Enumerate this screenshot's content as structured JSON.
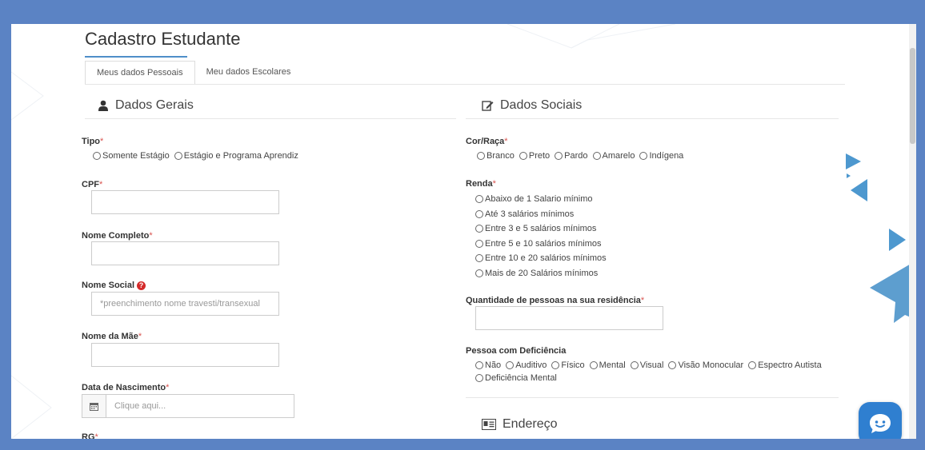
{
  "page": {
    "title": "Cadastro Estudante",
    "tabs": [
      {
        "label": "Meus dados Pessoais",
        "active": true
      },
      {
        "label": "Meu dados Escolares",
        "active": false
      }
    ]
  },
  "colors": {
    "frame": "#5b83c4",
    "accent": "#4f8fc9",
    "required": "#d9534f",
    "chat": "#2f7fd0"
  },
  "left": {
    "header": "Dados Gerais",
    "header_icon": "user-icon",
    "tipo": {
      "label": "Tipo",
      "required": "*",
      "options": [
        "Somente Estágio",
        "Estágio e Programa Aprendiz"
      ]
    },
    "cpf": {
      "label": "CPF",
      "required": "*",
      "value": ""
    },
    "nome_completo": {
      "label": "Nome Completo",
      "required": "*",
      "value": ""
    },
    "nome_social": {
      "label": "Nome Social",
      "help_icon": "question-circle-icon",
      "help_glyph": "?",
      "placeholder": "*preenchimento nome travesti/transexual"
    },
    "nome_mae": {
      "label": "Nome da Mãe",
      "required": "*",
      "value": ""
    },
    "data_nascimento": {
      "label": "Data de Nascimento",
      "required": "*",
      "icon": "calendar-icon",
      "placeholder": "Clique aqui..."
    },
    "rg": {
      "label": "RG",
      "required": "*"
    }
  },
  "right": {
    "header": "Dados Sociais",
    "header_icon": "edit-icon",
    "cor_raca": {
      "label": "Cor/Raça",
      "required": "*",
      "options": [
        "Branco",
        "Preto",
        "Pardo",
        "Amarelo",
        "Indígena"
      ]
    },
    "renda": {
      "label": "Renda",
      "required": "*",
      "options": [
        "Abaixo de 1 Salario mínimo",
        "Até 3 salários mínimos",
        "Entre 3 e 5 salários mínimos",
        "Entre 5 e 10 salários mínimos",
        "Entre 10 e 20 salários mínimos",
        "Mais de 20 Salários mínimos"
      ]
    },
    "qtd_pessoas": {
      "label": "Quantidade de pessoas na sua residência",
      "required": "*",
      "value": ""
    },
    "deficiencia": {
      "label": "Pessoa com Deficiência",
      "options": [
        "Não",
        "Auditivo",
        "Físico",
        "Mental",
        "Visual",
        "Visão Monocular",
        "Espectro Autista",
        "Deficiência Mental"
      ]
    },
    "endereco_header": "Endereço",
    "endereco_icon": "address-card-icon"
  },
  "chat_icon": "chat-bubble-icon"
}
